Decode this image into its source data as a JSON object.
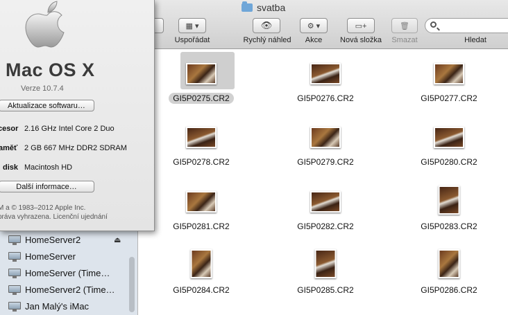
{
  "window": {
    "title": "svatba"
  },
  "toolbar": {
    "arrange": "Uspořádat",
    "quicklook": "Rychlý náhled",
    "action": "Akce",
    "new_folder": "Nová složka",
    "delete": "Smazat",
    "search": "Hledat"
  },
  "sidebar": {
    "items": [
      {
        "label": "HomeServer2",
        "eject": true
      },
      {
        "label": "HomeServer"
      },
      {
        "label": "HomeServer (Time…"
      },
      {
        "label": "HomeServer2 (Time…"
      },
      {
        "label": "Jan Malý's iMac"
      }
    ]
  },
  "files": [
    {
      "name": "GI5P0275.CR2",
      "orientation": "landscape",
      "selected": true
    },
    {
      "name": "GI5P0276.CR2",
      "orientation": "landscape"
    },
    {
      "name": "GI5P0277.CR2",
      "orientation": "landscape"
    },
    {
      "name": "GI5P0278.CR2",
      "orientation": "landscape"
    },
    {
      "name": "GI5P0279.CR2",
      "orientation": "landscape"
    },
    {
      "name": "GI5P0280.CR2",
      "orientation": "landscape"
    },
    {
      "name": "GI5P0281.CR2",
      "orientation": "landscape"
    },
    {
      "name": "GI5P0282.CR2",
      "orientation": "landscape"
    },
    {
      "name": "GI5P0283.CR2",
      "orientation": "portrait"
    },
    {
      "name": "GI5P0284.CR2",
      "orientation": "portrait"
    },
    {
      "name": "GI5P0285.CR2",
      "orientation": "portrait"
    },
    {
      "name": "GI5P0286.CR2",
      "orientation": "portrait"
    }
  ],
  "about": {
    "os_name": "Mac OS X",
    "version": "Verze 10.7.4",
    "update_button": "Aktualizace softwaru…",
    "specs": [
      {
        "label": "cesor",
        "value": "2.16 GHz Intel Core 2 Duo"
      },
      {
        "label": "aměť",
        "value": "2 GB 667 MHz  DDR2 SDRAM"
      },
      {
        "label": "disk",
        "value": "Macintosh HD"
      }
    ],
    "more_info_button": "Další informace…",
    "copyright_line1": "M a © 1983–2012 Apple Inc.",
    "copyright_line2": "práva vyhrazena.  Licenční ujednání"
  }
}
